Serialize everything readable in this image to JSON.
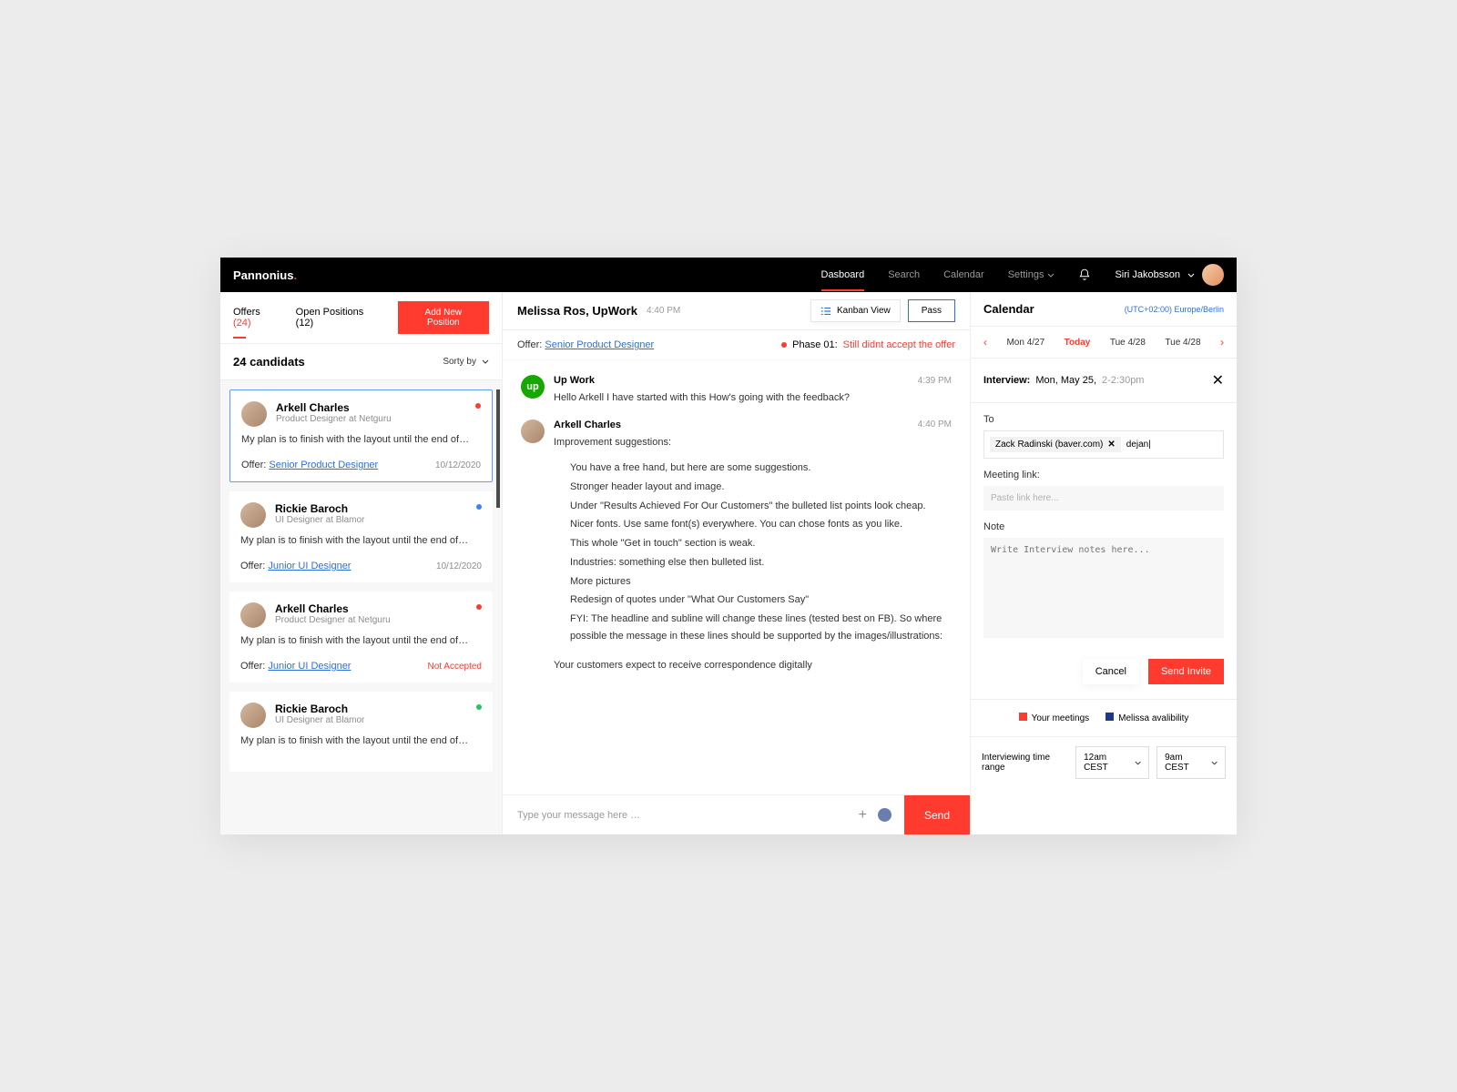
{
  "brand": "Pannonius",
  "topnav": {
    "dashboard": "Dasboard",
    "search": "Search",
    "calendar": "Calendar",
    "settings": "Settings"
  },
  "user": {
    "name": "Siri Jakobsson"
  },
  "left": {
    "tab_offers": "Offers",
    "offers_count": "(24)",
    "tab_open": "Open Positions (12)",
    "add_btn": "Add New Position",
    "header": "24 candidats",
    "sortby": "Sorty by",
    "cards": [
      {
        "name": "Arkell Charles",
        "title": "Product Designer at Netguru",
        "msg": "My plan is to finish with the layout until the end of…",
        "offer_lbl": "Offer:",
        "offer_link": "Senior Product Designer",
        "date": "10/12/2020",
        "dot": "red",
        "selected": true
      },
      {
        "name": "Rickie Baroch",
        "title": "UI Designer at Blamor",
        "msg": "My plan is to finish with the layout until the end of…",
        "offer_lbl": "Offer:",
        "offer_link": "Junior UI Designer",
        "date": "10/12/2020",
        "dot": "blue",
        "selected": false
      },
      {
        "name": "Arkell Charles",
        "title": "Product Designer at Netguru",
        "msg": "My plan is to finish with the layout until the end of…",
        "offer_lbl": "Offer:",
        "offer_link": "Junior UI Designer",
        "status": "Not Accepted",
        "dot": "red",
        "selected": false
      },
      {
        "name": "Rickie Baroch",
        "title": "UI Designer at Blamor",
        "msg": "My plan is to finish with the layout until the end of…",
        "dot": "green",
        "selected": false
      }
    ]
  },
  "mid": {
    "title": "Melissa Ros, UpWork",
    "time": "4:40 PM",
    "kanban": "Kanban View",
    "pass": "Pass",
    "offer_lbl": "Offer:",
    "offer_link": "Senior Product Designer",
    "phase_lbl": "Phase 01:",
    "phase_txt": "Still didnt accept the offer",
    "messages": [
      {
        "avatar": "up",
        "name": "Up Work",
        "time": "4:39 PM",
        "text": "Hello Arkell I have started with this How's going with the feedback?"
      },
      {
        "avatar": "person",
        "name": "Arkell Charles",
        "time": "4:40 PM",
        "intro": "Improvement suggestions:",
        "lines": [
          "You have a free hand, but here are some suggestions.",
          "Stronger header layout and image.",
          "Under \"Results Achieved For Our Customers\" the bulleted list points look cheap.",
          "Nicer fonts. Use same font(s) everywhere. You can chose fonts as you like.",
          "This whole \"Get in touch\" section is weak.",
          "Industries: something else then bulleted list.",
          "More pictures",
          "Redesign of quotes under \"What Our Customers Say\"",
          "FYI: The headline and subline will change these lines (tested best on FB). So where possible the message in these lines should be supported by the images/illustrations:"
        ],
        "closing": "Your customers expect to receive correspondence digitally"
      }
    ],
    "composer_placeholder": "Type your message here …",
    "send": "Send"
  },
  "right": {
    "title": "Calendar",
    "tz": "(UTC+02:00) Europe/Berlin",
    "days": {
      "mon": "Mon 4/27",
      "today": "Today",
      "tue1": "Tue 4/28",
      "tue2": "Tue 4/28"
    },
    "interview_lbl": "Interview:",
    "interview_date": "Mon, May 25,",
    "interview_time": "2-2:30pm",
    "to_lbl": "To",
    "chip": "Zack Radinski (baver.com)",
    "to_value": "dejan|",
    "meeting_lbl": "Meeting link:",
    "meeting_placeholder": "Paste link here...",
    "note_lbl": "Note",
    "note_placeholder": "Write Interview notes here...",
    "cancel": "Cancel",
    "invite": "Send Invite",
    "legend_mine": "Your meetings",
    "legend_avail": "Melissa avalibility",
    "range_lbl": "Interviewing time range",
    "range_from": "12am CEST",
    "range_to": "9am CEST"
  }
}
